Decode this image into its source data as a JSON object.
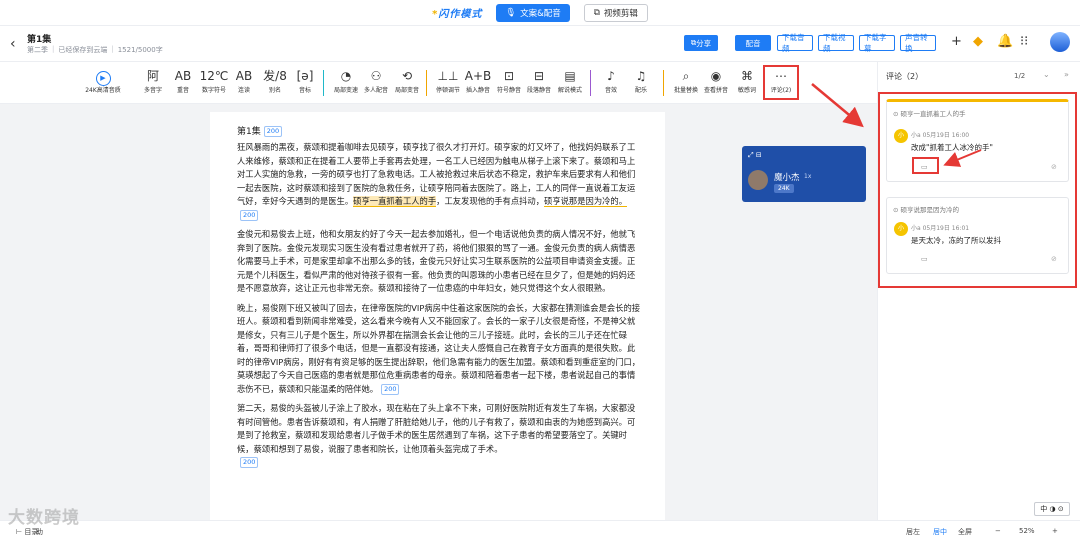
{
  "modebar": {
    "logo": "闪作模式",
    "tab_active": "文案&配音",
    "tab_other": "视频剪辑"
  },
  "header": {
    "episode_title": "第1集",
    "season": "第二季",
    "save_status": "已经保存到云端",
    "word_count": "1521/5000字",
    "buttons": {
      "share": "分享",
      "dub": "配音",
      "download_audio": "下载音频",
      "download_video": "下载视频",
      "download_subtitle": "下载字幕",
      "voice_convert": "声音转换"
    }
  },
  "toolbar": {
    "items": [
      {
        "icon": "play-circle-icon",
        "glyph": "▶",
        "label": "24K高清音质"
      },
      {
        "icon": "polyphone-icon",
        "glyph": "阿",
        "label": "多音字"
      },
      {
        "icon": "stress-icon",
        "glyph": "AB",
        "label": "重音"
      },
      {
        "icon": "digit-symbol-icon",
        "glyph": "12℃",
        "label": "数字符号"
      },
      {
        "icon": "liaison-icon",
        "glyph": "AB",
        "label": "连读"
      },
      {
        "icon": "alias-icon",
        "glyph": "发/8",
        "label": "别名"
      },
      {
        "icon": "phonetic-icon",
        "glyph": "[ə]",
        "label": "音标"
      },
      {
        "icon": "local-speed-icon",
        "glyph": "◔",
        "label": "局部变速"
      },
      {
        "icon": "multi-voice-icon",
        "glyph": "⚇",
        "label": "多人配音"
      },
      {
        "icon": "local-voice-icon",
        "glyph": "⟲",
        "label": "局部变音"
      },
      {
        "icon": "pause-adjust-icon",
        "glyph": "⊥⊥",
        "label": "停顿调节"
      },
      {
        "icon": "insert-silence-icon",
        "glyph": "A+B",
        "label": "插入静音"
      },
      {
        "icon": "symbol-silence-icon",
        "glyph": "⊡",
        "label": "符号静音"
      },
      {
        "icon": "paragraph-silence-icon",
        "glyph": "⊟",
        "label": "段落静音"
      },
      {
        "icon": "narration-icon",
        "glyph": "▤",
        "label": "解说模式"
      },
      {
        "icon": "sound-effect-icon",
        "glyph": "♪",
        "label": "音效"
      },
      {
        "icon": "music-icon",
        "glyph": "♫",
        "label": "配乐"
      },
      {
        "icon": "batch-replace-icon",
        "glyph": "⌕",
        "label": "批量替换"
      },
      {
        "icon": "view-pinyin-icon",
        "glyph": "◉",
        "label": "查看拼音"
      },
      {
        "icon": "sensitive-word-icon",
        "glyph": "⌘",
        "label": "敏感词"
      },
      {
        "icon": "comment-icon",
        "glyph": "⋯",
        "label": "评论(2)"
      }
    ]
  },
  "document": {
    "heading": "第1集",
    "tag": "200",
    "paragraphs": [
      {
        "pre": "狂风暴雨的黑夜，蔡颂和提着咖啡去见硕亨，硕亨找了很久才打开灯。硕亨家的灯又坏了，他找妈妈联系了工人来维修，蔡颂和正在提着工人要带上手套再去处理，一名工人已经因为触电从梯子上滚下来了。蔡颂和马上对工人实施的急救，一旁的硕亨也打了急救电话。工人被抢救过来后状态不稳定，救护车来后要求有人和他们一起去医院，这时蔡颂和接到了医院的急救任务，让硕亨陪同着去医院了。路上，工人的同伴一直说着工友运气好，幸好今天遇到的是医生。",
        "hl1": "硕亨一直抓着工人的手",
        "mid": "，工友发现他的手有点抖动，",
        "hl2": "硕亨说那是因为冷的。"
      },
      {
        "text": "金俊元和易俊去上班，他和女朋友约好了今天一起去参加婚礼，但一个电话说他负责的病人情况不好，他就飞奔到了医院。金俊元发现实习医生没有看过患者就开了药，将他们狠狠的骂了一通。金俊元负责的病人病情恶化需要马上手术，可是家里却拿不出那么多的钱，金俊元只好让实习生联系医院的公益项目申请资金支援。正元是个儿科医生，看似严肃的他对待孩子很有一套。他负责的叫恩珠的小患者已经在旦夕了，但是她的妈妈还是不愿意放弃，这让正元也非常无奈。蔡颂和接待了一位患癌的中年妇女，她只觉得这个女人很眼熟。"
      },
      {
        "text": "晚上，易俊刚下班又被叫了回去，在律帝医院的VIP病房中住着这家医院的会长，大家都在猜测谁会是会长的接班人。蔡颂和看到新闻非常难受，这么看来今晚有人又不能回家了。会长的一家子儿女很是奇怪，不是神父就是修女，只有三儿子是个医生，所以外界都在揣测会长会让他的三儿子接班。此时，会长的三儿子还在忙碌着，哥哥和律师打了很多个电话，但是一直都没有接通，这让夫人感慨自己在教育子女方面真的是很失败。此时的律帝VIP病房，刚好有有资足够的医生提出辞职，他们急需有能力的医生加盟。蔡颂和看到重症室的门口，莫瑛想起了今天自己医癌的患者就是那位危重病患者的母亲。蔡颂和陪着患者一起下楼，患者说起自己的事情悲伤不已，蔡颂和只能温柔的陪伴她。"
      },
      {
        "text": "第二天，易俊的头盔被儿子涂上了胶水，现在粘在了头上拿不下来，可刚好医院附近有发生了车祸，大家都没有时间管他。患者告诉蔡颂和，有人捐赠了肝脏给她儿子，他的儿子有救了，蔡颂和由衷的为她感到高兴。可是到了抢救室，蔡颂和发现给患者儿子做手术的医生居然遇到了车祸，这下子患者的希望要落空了。关键时候，蔡颂和想到了易俊，说服了患者和院长，让他顶着头盔完成了手术。"
      }
    ]
  },
  "speaker_card": {
    "name": "魔小杰",
    "speed": "1x",
    "badge": "24K"
  },
  "comments_panel": {
    "title": "评论（2）",
    "page": "1/2",
    "comments": [
      {
        "reference": "硕亨一直抓着工人的手",
        "author_initial": "小",
        "author": "小a",
        "time": "05月19日 16:00",
        "text": "改成\"抓着工人冰冷的手\""
      },
      {
        "reference": "硕亨说那是因为冷的",
        "author_initial": "小",
        "author": "小a",
        "time": "05月19日 16:01",
        "text": "是天太冷，冻的了所以发抖"
      }
    ]
  },
  "statusbar": {
    "catalog": "目录",
    "assistant": "助",
    "align_bottom": "居左",
    "align_center": "居中",
    "fullscreen": "全屏",
    "zoom": "52%",
    "floater": "中"
  },
  "watermark": "大数跨境"
}
